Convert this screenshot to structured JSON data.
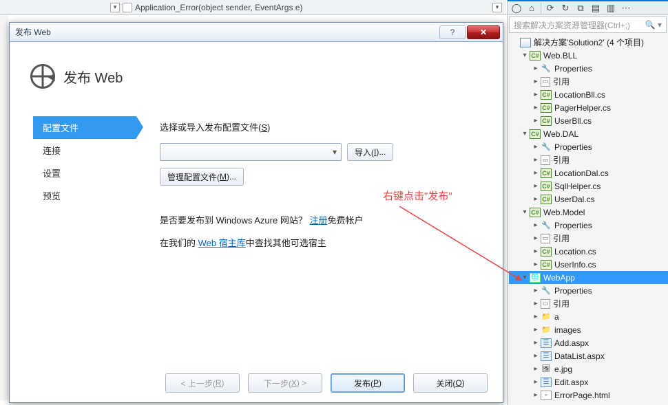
{
  "editor": {
    "method_signature": "Application_Error(object sender, EventArgs e)"
  },
  "solution_explorer": {
    "search_placeholder": "搜索解决方案资源管理器(Ctrl+;)",
    "solution_label": "解决方案'Solution2' (4 个项目)",
    "projects": [
      {
        "name": "Web.BLL",
        "items": [
          {
            "icon": "wrench",
            "label": "Properties"
          },
          {
            "icon": "ref",
            "label": "引用"
          },
          {
            "icon": "cs",
            "label": "LocationBll.cs"
          },
          {
            "icon": "cs",
            "label": "PagerHelper.cs"
          },
          {
            "icon": "cs",
            "label": "UserBll.cs"
          }
        ]
      },
      {
        "name": "Web.DAL",
        "items": [
          {
            "icon": "wrench",
            "label": "Properties"
          },
          {
            "icon": "ref",
            "label": "引用"
          },
          {
            "icon": "cs",
            "label": "LocationDal.cs"
          },
          {
            "icon": "cs",
            "label": "SqlHelper.cs"
          },
          {
            "icon": "cs",
            "label": "UserDal.cs"
          }
        ]
      },
      {
        "name": "Web.Model",
        "items": [
          {
            "icon": "wrench",
            "label": "Properties"
          },
          {
            "icon": "ref",
            "label": "引用"
          },
          {
            "icon": "cs",
            "label": "Location.cs"
          },
          {
            "icon": "cs",
            "label": "UserInfo.cs"
          }
        ]
      },
      {
        "name": "WebApp",
        "selected": true,
        "items": [
          {
            "icon": "wrench",
            "label": "Properties"
          },
          {
            "icon": "ref",
            "label": "引用"
          },
          {
            "icon": "folder",
            "label": "a"
          },
          {
            "icon": "folder",
            "label": "images"
          },
          {
            "icon": "aspx",
            "label": "Add.aspx"
          },
          {
            "icon": "aspx",
            "label": "DataList.aspx"
          },
          {
            "icon": "img",
            "label": "e.jpg"
          },
          {
            "icon": "aspx",
            "label": "Edit.aspx"
          },
          {
            "icon": "html",
            "label": "ErrorPage.html"
          }
        ]
      }
    ]
  },
  "dialog": {
    "window_title": "发布 Web",
    "header_title": "发布 Web",
    "nav": {
      "profile": "配置文件",
      "connection": "连接",
      "settings": "设置",
      "preview": "预览"
    },
    "form": {
      "select_profile_label_pre": "选择或导入发布配置文件(",
      "select_profile_hotkey": "S",
      "select_profile_label_post": ")",
      "import_btn_pre": "导入(",
      "import_btn_hotkey": "I",
      "import_btn_post": ")...",
      "manage_btn_pre": "管理配置文件(",
      "manage_btn_hotkey": "M",
      "manage_btn_post": ")...",
      "azure_text_pre": "是否要发布到 Windows Azure 网站？",
      "azure_link": "注册",
      "azure_text_post": "免费帐户",
      "host_text_pre": "在我们的 ",
      "host_link": "Web 宿主库",
      "host_text_post": "中查找其他可选宿主"
    },
    "buttons": {
      "prev_pre": "< 上一步(",
      "prev_hot": "R",
      "prev_post": ")",
      "next_pre": "下一步(",
      "next_hot": "X",
      "next_post": ") >",
      "publish_pre": "发布(",
      "publish_hot": "P",
      "publish_post": ")",
      "close_pre": "关闭(",
      "close_hot": "O",
      "close_post": ")"
    }
  },
  "annotation": "右键点击\"发布\""
}
